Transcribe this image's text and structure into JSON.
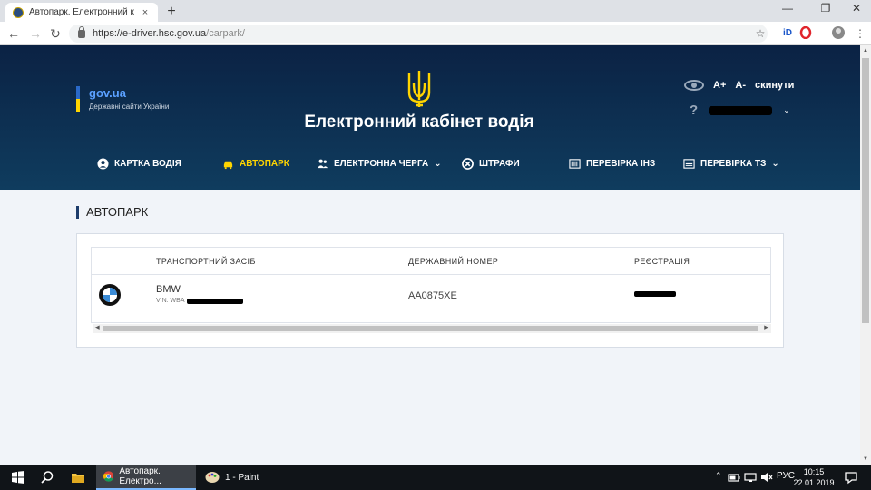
{
  "browser": {
    "tab_title": "Автопарк. Електронний кабінет",
    "tab_close": "×",
    "new_tab": "+",
    "window_controls": {
      "minimize": "—",
      "restore": "❐",
      "close": "✕"
    },
    "nav": {
      "back": "←",
      "forward": "→",
      "reload": "↻"
    },
    "url_host": "https://e-driver.hsc.gov.ua",
    "url_path": "/carpark/",
    "bookmark": "☆"
  },
  "header": {
    "gov_logo": "gov.ua",
    "gov_subtitle": "Державні сайти України",
    "site_title": "Електронний кабінет водія",
    "font_increase": "A+",
    "font_decrease": "A-",
    "font_reset": "скинути",
    "help": "?",
    "user_chevron": "⌄"
  },
  "nav": {
    "items": [
      {
        "label": "КАРТКА ВОДІЯ"
      },
      {
        "label": "АВТОПАРК"
      },
      {
        "label": "ЕЛЕКТРОННА ЧЕРГА",
        "chevron": "⌄"
      },
      {
        "label": "ШТРАФИ"
      },
      {
        "label": "ПЕРЕВІРКА ІНЗ"
      },
      {
        "label": "ПЕРЕВІРКА ТЗ",
        "chevron": "⌄"
      }
    ]
  },
  "page": {
    "section_title": "АВТОПАРК",
    "table": {
      "headers": [
        "ТРАНСПОРТНИЙ ЗАСІБ",
        "ДЕРЖАВНИЙ НОМЕР",
        "РЕЄСТРАЦІЯ"
      ],
      "rows": [
        {
          "vehicle": "BMW",
          "vin_prefix": "VIN: WBA",
          "plate": "AA0875XE"
        }
      ]
    },
    "scroll_left": "◀",
    "scroll_right": "▶",
    "scroll_up": "▲",
    "scroll_down": "▼"
  },
  "taskbar": {
    "apps": [
      {
        "label": "Автопарк. Електро..."
      },
      {
        "label": "1 - Paint"
      }
    ],
    "tray": {
      "language": "РУС",
      "up_arrow": "⌃"
    },
    "time": "10:15",
    "date": "22.01.2019"
  },
  "colors": {
    "header_bg": "#0b2244",
    "active_nav": "#ffd500",
    "gov_blue": "#2a69c8"
  }
}
